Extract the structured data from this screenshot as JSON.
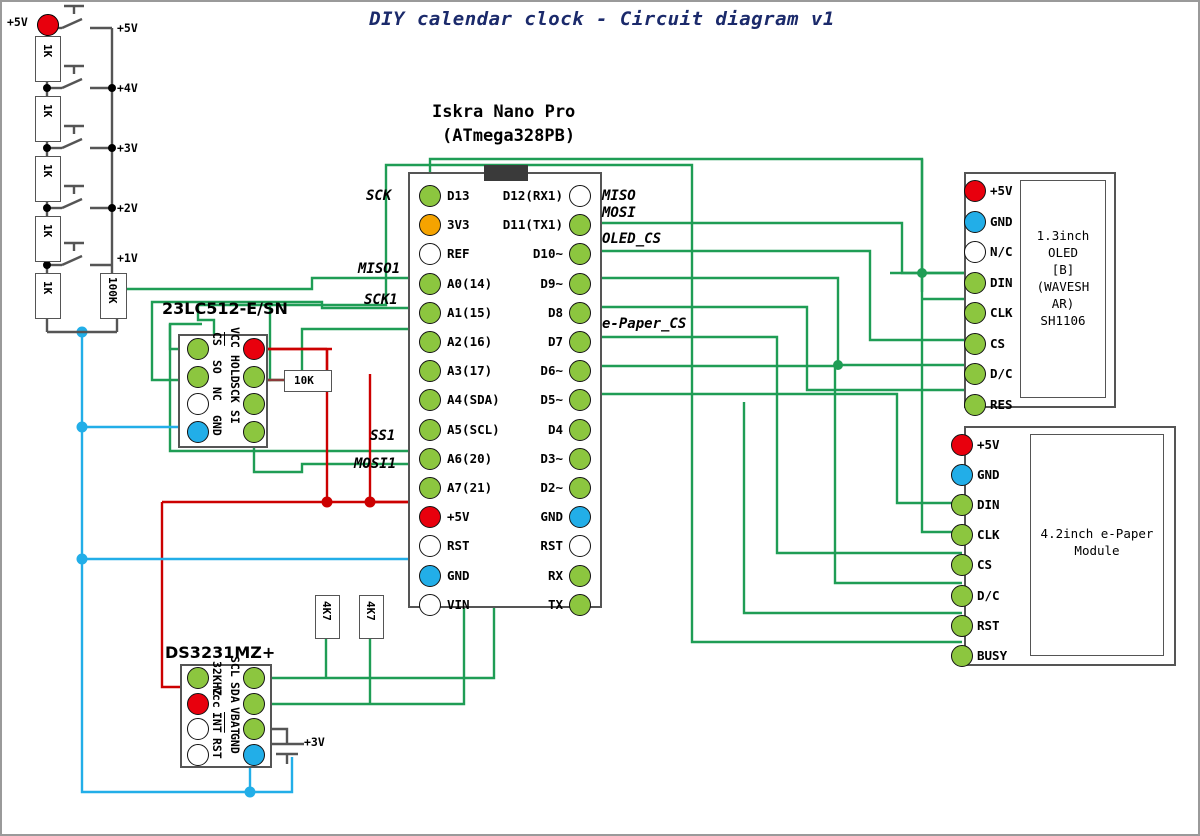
{
  "title": "DIY calendar clock - Circuit diagram v1",
  "colors": {
    "wire_red": "#cc0000",
    "wire_green": "#1f9d55",
    "wire_cyan": "#22aee8",
    "wire_black": "#555555",
    "pin_green": "#8cc63f",
    "pin_red": "#e8000d",
    "pin_blue": "#22aee8",
    "pin_white": "#ffffff",
    "pin_orange": "#f5a300",
    "title_blue": "#1b2a6b",
    "box_outline": "#555555"
  },
  "button_ladder": {
    "supply_label": "+5V",
    "resistors": [
      "1K",
      "1K",
      "1K",
      "1K",
      "1K"
    ],
    "pulldown": "100K",
    "taps": [
      "+5V",
      "+4V",
      "+3V",
      "+2V",
      "+1V"
    ],
    "button_count": 5
  },
  "board": {
    "name": "Iskra Nano Pro",
    "mcu": "(ATmega328PB)",
    "left_pins": [
      {
        "label": "D13",
        "color": "green"
      },
      {
        "label": "3V3",
        "color": "orange"
      },
      {
        "label": "REF",
        "color": "white"
      },
      {
        "label": "A0(14)",
        "color": "green"
      },
      {
        "label": "A1(15)",
        "color": "green"
      },
      {
        "label": "A2(16)",
        "color": "green"
      },
      {
        "label": "A3(17)",
        "color": "green"
      },
      {
        "label": "A4(SDA)",
        "color": "green"
      },
      {
        "label": "A5(SCL)",
        "color": "green"
      },
      {
        "label": "A6(20)",
        "color": "green"
      },
      {
        "label": "A7(21)",
        "color": "green"
      },
      {
        "label": "+5V",
        "color": "red"
      },
      {
        "label": "RST",
        "color": "white"
      },
      {
        "label": "GND",
        "color": "blue"
      },
      {
        "label": "VIN",
        "color": "white"
      }
    ],
    "right_pins": [
      {
        "label": "D12(RX1)",
        "color": "white"
      },
      {
        "label": "D11(TX1)",
        "color": "green"
      },
      {
        "label": "D10~",
        "color": "green"
      },
      {
        "label": "D9~",
        "color": "green"
      },
      {
        "label": "D8",
        "color": "green"
      },
      {
        "label": "D7",
        "color": "green"
      },
      {
        "label": "D6~",
        "color": "green"
      },
      {
        "label": "D5~",
        "color": "green"
      },
      {
        "label": "D4",
        "color": "green"
      },
      {
        "label": "D3~",
        "color": "green"
      },
      {
        "label": "D2~",
        "color": "green"
      },
      {
        "label": "GND",
        "color": "blue"
      },
      {
        "label": "RST",
        "color": "white"
      },
      {
        "label": "RX",
        "color": "green"
      },
      {
        "label": "TX",
        "color": "green"
      }
    ],
    "signal_labels_left": [
      "SCK",
      "MISO1",
      "SCK1",
      "SS1",
      "MOSI1"
    ],
    "signal_labels_right": [
      "MISO",
      "MOSI",
      "OLED_CS",
      "e-Paper_CS"
    ]
  },
  "sram": {
    "name": "23LC512-E/SN",
    "left_pins": [
      {
        "label": "CS",
        "color": "green",
        "overline": true
      },
      {
        "label": "SO",
        "color": "green",
        "overline": false
      },
      {
        "label": "NC",
        "color": "white",
        "overline": false
      },
      {
        "label": "GND",
        "color": "blue",
        "overline": false
      }
    ],
    "right_pins": [
      {
        "label": "VCC",
        "color": "red",
        "overline": false
      },
      {
        "label": "HOLD",
        "color": "green",
        "overline": false
      },
      {
        "label": "SCK",
        "color": "green",
        "overline": false
      },
      {
        "label": "SI",
        "color": "green",
        "overline": false
      }
    ],
    "pullup": "10K"
  },
  "rtc": {
    "name": "DS3231MZ+",
    "left_pins": [
      {
        "label": "32KHZ",
        "color": "green",
        "overline": false
      },
      {
        "label": "Vcc",
        "color": "red",
        "overline": false
      },
      {
        "label": "INT",
        "color": "white",
        "overline": true
      },
      {
        "label": "RST",
        "color": "white",
        "overline": false
      }
    ],
    "right_pins": [
      {
        "label": "SCL",
        "color": "green",
        "overline": false
      },
      {
        "label": "SDA",
        "color": "green",
        "overline": false
      },
      {
        "label": "VBAT",
        "color": "green",
        "overline": false
      },
      {
        "label": "GND",
        "color": "blue",
        "overline": false
      }
    ],
    "battery_label": "+3V"
  },
  "i2c_pullups": [
    "4K7",
    "4K7"
  ],
  "oled": {
    "body_lines": [
      "1.3inch",
      "OLED",
      "[B]",
      "(WAVESH",
      "AR)",
      "SH1106"
    ],
    "pins": [
      {
        "label": "+5V",
        "color": "red"
      },
      {
        "label": "GND",
        "color": "blue"
      },
      {
        "label": "N/C",
        "color": "white"
      },
      {
        "label": "DIN",
        "color": "green"
      },
      {
        "label": "CLK",
        "color": "green"
      },
      {
        "label": "CS",
        "color": "green"
      },
      {
        "label": "D/C",
        "color": "green"
      },
      {
        "label": "RES",
        "color": "green"
      }
    ]
  },
  "epaper": {
    "body_lines": [
      "4.2inch e-Paper",
      "Module"
    ],
    "pins": [
      {
        "label": "+5V",
        "color": "red"
      },
      {
        "label": "GND",
        "color": "blue"
      },
      {
        "label": "DIN",
        "color": "green"
      },
      {
        "label": "CLK",
        "color": "green"
      },
      {
        "label": "CS",
        "color": "green"
      },
      {
        "label": "D/C",
        "color": "green"
      },
      {
        "label": "RST",
        "color": "green"
      },
      {
        "label": "BUSY",
        "color": "green"
      }
    ]
  }
}
